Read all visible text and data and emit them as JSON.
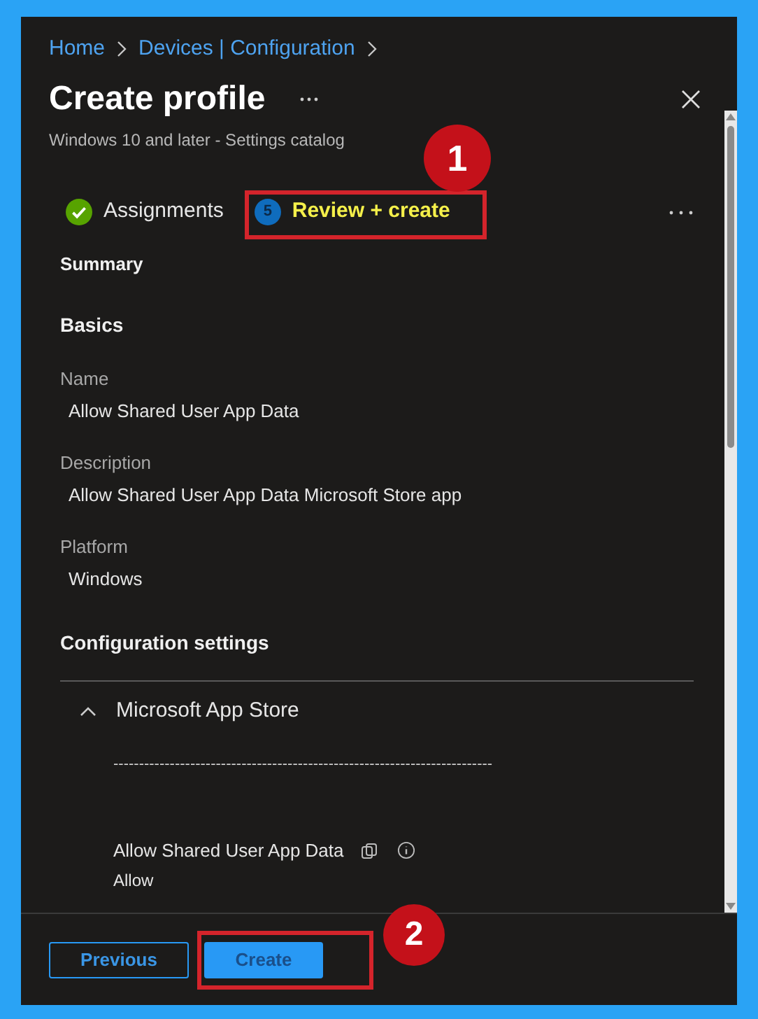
{
  "breadcrumb": [
    "Home",
    "Devices | Configuration"
  ],
  "title": "Create profile",
  "subtitle": "Windows 10 and later - Settings catalog",
  "steps": [
    {
      "kind": "done",
      "label": "Assignments",
      "selected": false
    },
    {
      "kind": "number",
      "number": "5",
      "label": "Review + create",
      "selected": true
    }
  ],
  "summary_heading": "Summary",
  "basics_heading": "Basics",
  "fields": [
    {
      "label": "Name",
      "value": "Allow Shared User App Data"
    },
    {
      "label": "Description",
      "value": "Allow Shared User App Data Microsoft Store app"
    },
    {
      "label": "Platform",
      "value": "Windows"
    }
  ],
  "config_heading": "Configuration settings",
  "category": {
    "name": "Microsoft App Store",
    "expanded": true,
    "separator": "--------------------------------------------------------------------------",
    "setting": {
      "name": "Allow Shared User App Data",
      "value": "Allow"
    }
  },
  "footer": {
    "buttons": [
      {
        "kind": "secondary",
        "label": "Previous"
      },
      {
        "kind": "primary",
        "label": "Create"
      }
    ]
  },
  "annotations": [
    {
      "number": "1"
    },
    {
      "number": "2"
    }
  ]
}
